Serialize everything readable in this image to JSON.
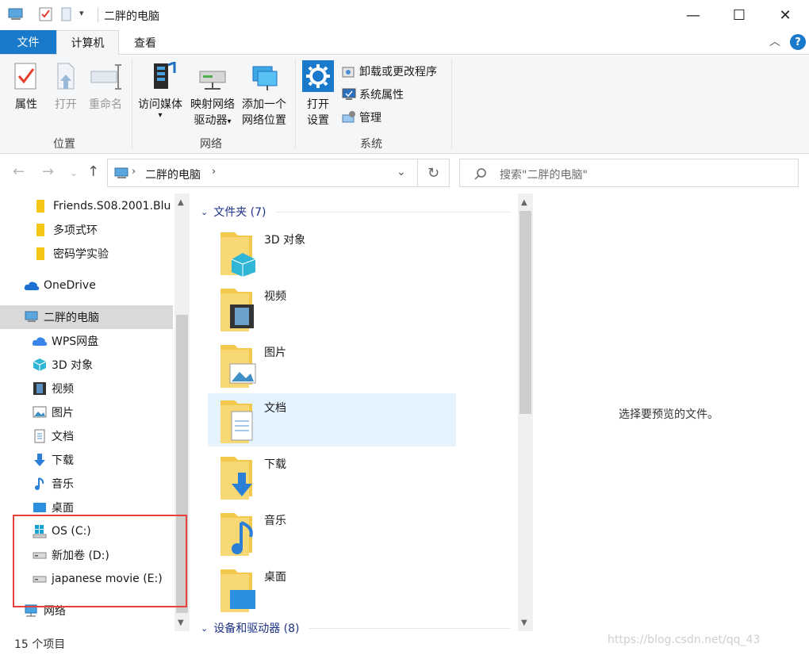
{
  "window": {
    "title": "二胖的电脑",
    "controls": [
      "—",
      "☐",
      "✕"
    ]
  },
  "ribbon_tabs": {
    "file": "文件",
    "computer": "计算机",
    "view": "查看",
    "help": "?"
  },
  "ribbon": {
    "location": {
      "label": "位置",
      "properties": "属性",
      "open": "打开",
      "rename": "重命名"
    },
    "network": {
      "label": "网络",
      "access_media": "访问媒体",
      "map_drive_1": "映射网络",
      "map_drive_2": "驱动器",
      "add_location_1": "添加一个",
      "add_location_2": "网络位置"
    },
    "system": {
      "label": "系统",
      "open_settings_1": "打开",
      "open_settings_2": "设置",
      "uninstall": "卸载或更改程序",
      "system_properties": "系统属性",
      "manage": "管理"
    }
  },
  "address": {
    "crumb": "二胖的电脑",
    "search_placeholder": "搜索\"二胖的电脑\""
  },
  "nav": {
    "items": [
      {
        "label": "Friends.S08.2001.Blu",
        "icon": "folder-icon"
      },
      {
        "label": "多项式环",
        "icon": "folder-icon"
      },
      {
        "label": "密码学实验",
        "icon": "folder-icon"
      },
      {
        "label": "OneDrive",
        "icon": "cloud-icon"
      },
      {
        "label": "二胖的电脑",
        "icon": "computer-icon"
      },
      {
        "label": "WPS网盘",
        "icon": "cloud-icon"
      },
      {
        "label": "3D 对象",
        "icon": "cube-icon"
      },
      {
        "label": "视频",
        "icon": "film-icon"
      },
      {
        "label": "图片",
        "icon": "picture-icon"
      },
      {
        "label": "文档",
        "icon": "document-icon"
      },
      {
        "label": "下载",
        "icon": "download-icon"
      },
      {
        "label": "音乐",
        "icon": "music-icon"
      },
      {
        "label": "桌面",
        "icon": "desktop-icon"
      },
      {
        "label": "OS (C:)",
        "icon": "windows-drive-icon"
      },
      {
        "label": "新加卷 (D:)",
        "icon": "drive-icon"
      },
      {
        "label": "japanese movie (E:)",
        "icon": "drive-icon"
      },
      {
        "label": "网络",
        "icon": "network-icon"
      }
    ]
  },
  "content": {
    "folders_header": "文件夹 (7)",
    "devices_header": "设备和驱动器 (8)",
    "folders": [
      {
        "label": "3D 对象"
      },
      {
        "label": "视频"
      },
      {
        "label": "图片"
      },
      {
        "label": "文档"
      },
      {
        "label": "下载"
      },
      {
        "label": "音乐"
      },
      {
        "label": "桌面"
      }
    ],
    "preview_message": "选择要预览的文件。"
  },
  "status": {
    "count": "15 个项目"
  },
  "watermark": "https://blog.csdn.net/qq_43"
}
